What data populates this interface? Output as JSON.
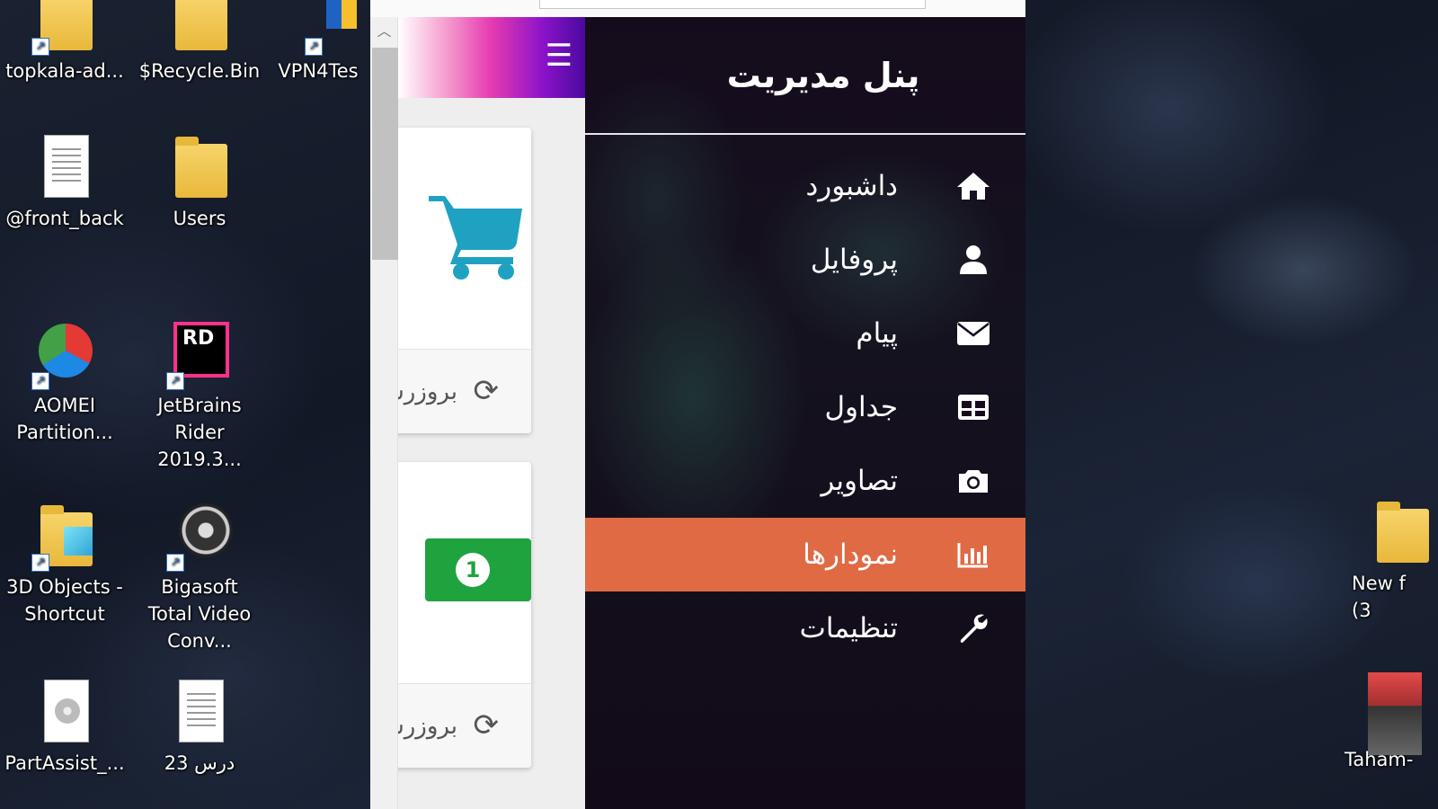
{
  "desktop": {
    "icons": [
      {
        "label": "topkala-ad..."
      },
      {
        "label": "$Recycle.Bin"
      },
      {
        "label": "VPN4Tes"
      },
      {
        "label": "@front_back"
      },
      {
        "label": "Users"
      },
      {
        "label": "AOMEI Partition..."
      },
      {
        "label": "JetBrains Rider 2019.3..."
      },
      {
        "label": "3D Objects - Shortcut"
      },
      {
        "label": "Bigasoft Total Video Conv..."
      },
      {
        "label": "PartAssist_..."
      },
      {
        "label": "درس 23"
      },
      {
        "label": "New f (3"
      },
      {
        "label": "Taham-"
      }
    ]
  },
  "browser": {
    "scroll_up_glyph": "︿"
  },
  "app": {
    "hamburger_glyph": "☰",
    "sidebar_title": "پنل مدیریت",
    "menu": [
      {
        "label": "داشبورد",
        "icon": "home-icon",
        "active": false
      },
      {
        "label": "پروفایل",
        "icon": "user-icon",
        "active": false
      },
      {
        "label": "پیام",
        "icon": "envelope-icon",
        "active": false
      },
      {
        "label": "جداول",
        "icon": "table-icon",
        "active": false
      },
      {
        "label": "تصاویر",
        "icon": "camera-icon",
        "active": false
      },
      {
        "label": "نمودارها",
        "icon": "bar-chart-icon",
        "active": true
      },
      {
        "label": "تنظیمات",
        "icon": "wrench-icon",
        "active": false
      }
    ],
    "cards": [
      {
        "icon": "cart-icon",
        "footer_label": "بروزرسانی",
        "footer_icon": "refresh-icon"
      },
      {
        "icon": "money-icon",
        "coin_text": "1",
        "footer_label": "بروزرسانی",
        "footer_icon": "refresh-icon"
      }
    ],
    "colors": {
      "active_item": "#e06a44",
      "cart": "#1fa2c2",
      "money": "#1fa33f"
    }
  }
}
